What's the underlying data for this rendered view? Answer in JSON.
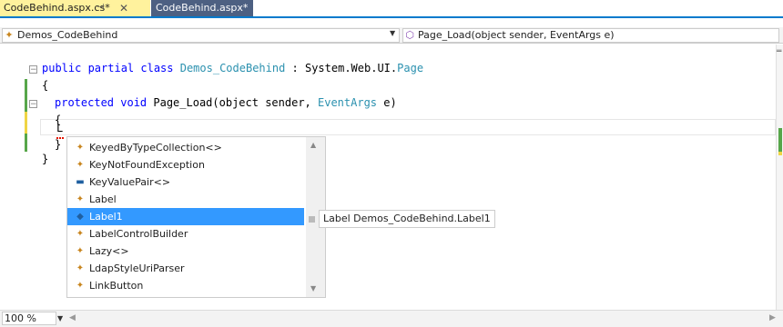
{
  "tabs": [
    {
      "label": "CodeBehind.aspx.cs*",
      "active": true
    },
    {
      "label": "CodeBehind.aspx*",
      "active": false
    }
  ],
  "nav": {
    "type_combo": "Demos_CodeBehind",
    "member_combo": "Page_Load(object sender, EventArgs e)"
  },
  "code": {
    "line1_kw": "public partial class ",
    "line1_type": "Demos_CodeBehind",
    "line1_colon": " : System.Web.UI.",
    "line1_base": "Page",
    "line2": "{",
    "line3_kw": "protected void ",
    "line3_name": "Page_Load(object sender, ",
    "line3_type": "EventArgs",
    "line3_end": " e)",
    "line4": "{",
    "line5": "L",
    "line6": "}",
    "line7": "}"
  },
  "completion": {
    "items": [
      {
        "label": "KeyedByTypeCollection<>",
        "icon": "class-icon",
        "selected": false
      },
      {
        "label": "KeyNotFoundException",
        "icon": "class-icon",
        "selected": false
      },
      {
        "label": "KeyValuePair<>",
        "icon": "struct-icon",
        "selected": false
      },
      {
        "label": "Label",
        "icon": "class-icon",
        "selected": false
      },
      {
        "label": "Label1",
        "icon": "field-icon",
        "selected": true
      },
      {
        "label": "LabelControlBuilder",
        "icon": "class-icon",
        "selected": false
      },
      {
        "label": "Lazy<>",
        "icon": "class-icon",
        "selected": false
      },
      {
        "label": "LdapStyleUriParser",
        "icon": "class-icon",
        "selected": false
      },
      {
        "label": "LinkButton",
        "icon": "class-icon",
        "selected": false
      }
    ],
    "tooltip": "Label Demos_CodeBehind.Label1"
  },
  "status": {
    "zoom": "100 %"
  },
  "colors": {
    "keyword": "#0000ff",
    "type": "#2b91af",
    "accent": "#007acc",
    "active_tab": "#fff29d",
    "selection": "#3399ff"
  }
}
